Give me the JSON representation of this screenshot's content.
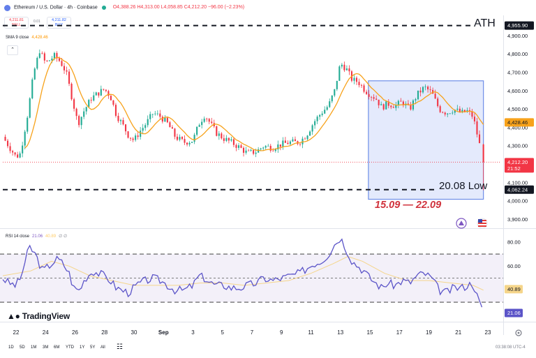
{
  "header": {
    "symbol_title": "Ethereum / U.S. Dollar · 4h · Coinbase",
    "open": "O4,388.26",
    "high": "H4,313.00",
    "low": "L4,058.85",
    "close": "C4,212.20",
    "change": "−96.00 (−2.23%)"
  },
  "trade": {
    "sell_price": "4,211.81",
    "sell_label": "SELL",
    "spread": "0.01",
    "buy_price": "4,211.82",
    "buy_label": "BUY"
  },
  "sma_legend": {
    "name": "SMA 9 close",
    "value": "4,428.46"
  },
  "rsi_legend": {
    "name": "RSI 14 close",
    "value1": "21.06",
    "value2": "40.89",
    "extra": "∅ ∅"
  },
  "brand": {
    "name": "TradingView"
  },
  "timeframes": [
    "1D",
    "5D",
    "1M",
    "3M",
    "6M",
    "YTD",
    "1Y",
    "5Y",
    "All"
  ],
  "clock": "03:38:08 UTC-4",
  "colors": {
    "up": "#22ab94",
    "down": "#f23645",
    "sma": "#f7a21b",
    "rsi": "#5b54c8",
    "rsi_ma": "#f5d58a",
    "box_fill": "#dbe3fb",
    "box_stroke": "#6e8ee8",
    "annot": "#d0323c"
  },
  "chart_data": [
    {
      "type": "candlestick",
      "title": "Ethereum / U.S. Dollar · 4h · Coinbase",
      "y_ticks": [
        4900,
        4800,
        4700,
        4600,
        4500,
        4400,
        4300,
        4200,
        4100,
        4000,
        3900
      ],
      "y_tick_labels": [
        "4,900.00",
        "4,800.00",
        "4,700.00",
        "4,600.00",
        "4,500.00",
        "4,400.00",
        "4,300.00",
        "4,200.00",
        "4,100.00",
        "4,000.00",
        "3,900.00"
      ],
      "ylim": [
        3860,
        5000
      ],
      "x_ticks": [
        "22",
        "24",
        "26",
        "28",
        "30",
        "Sep",
        "3",
        "5",
        "7",
        "9",
        "11",
        "13",
        "15",
        "17",
        "19",
        "21",
        "23"
      ],
      "x_tick_days": [
        0,
        2,
        4,
        6,
        8,
        10,
        12,
        14,
        16,
        18,
        20,
        22,
        24,
        26,
        28,
        30,
        32
      ],
      "xlim_days": [
        -0.9,
        32.9
      ],
      "sma_period": 9,
      "price_path": [
        [
          -0.9,
          4350
        ],
        [
          -0.5,
          4300
        ],
        [
          0,
          4240
        ],
        [
          0.3,
          4260
        ],
        [
          0.8,
          4480
        ],
        [
          1.2,
          4700
        ],
        [
          1.6,
          4820
        ],
        [
          2.0,
          4750
        ],
        [
          2.6,
          4790
        ],
        [
          3.0,
          4760
        ],
        [
          3.4,
          4700
        ],
        [
          3.8,
          4560
        ],
        [
          4.2,
          4420
        ],
        [
          4.6,
          4490
        ],
        [
          5.1,
          4560
        ],
        [
          5.6,
          4590
        ],
        [
          6.0,
          4610
        ],
        [
          6.4,
          4570
        ],
        [
          6.8,
          4470
        ],
        [
          7.2,
          4420
        ],
        [
          7.6,
          4360
        ],
        [
          8.0,
          4330
        ],
        [
          8.4,
          4380
        ],
        [
          8.8,
          4420
        ],
        [
          9.3,
          4480
        ],
        [
          9.8,
          4460
        ],
        [
          10.3,
          4420
        ],
        [
          10.8,
          4350
        ],
        [
          11.4,
          4320
        ],
        [
          12.0,
          4330
        ],
        [
          12.4,
          4420
        ],
        [
          12.8,
          4470
        ],
        [
          13.2,
          4420
        ],
        [
          13.6,
          4370
        ],
        [
          14.1,
          4340
        ],
        [
          14.6,
          4320
        ],
        [
          15.2,
          4290
        ],
        [
          15.7,
          4260
        ],
        [
          16.3,
          4270
        ],
        [
          16.8,
          4300
        ],
        [
          17.4,
          4290
        ],
        [
          18.0,
          4310
        ],
        [
          18.6,
          4320
        ],
        [
          19.2,
          4320
        ],
        [
          19.7,
          4360
        ],
        [
          20.2,
          4430
        ],
        [
          20.7,
          4480
        ],
        [
          21.2,
          4520
        ],
        [
          21.6,
          4600
        ],
        [
          22.0,
          4750
        ],
        [
          22.4,
          4720
        ],
        [
          22.8,
          4660
        ],
        [
          23.2,
          4650
        ],
        [
          23.6,
          4610
        ],
        [
          24.0,
          4580
        ],
        [
          24.4,
          4560
        ],
        [
          24.8,
          4510
        ],
        [
          25.2,
          4530
        ],
        [
          25.7,
          4520
        ],
        [
          26.2,
          4540
        ],
        [
          26.7,
          4500
        ],
        [
          27.2,
          4580
        ],
        [
          27.7,
          4620
        ],
        [
          28.2,
          4590
        ],
        [
          28.7,
          4500
        ],
        [
          29.2,
          4480
        ],
        [
          29.7,
          4500
        ],
        [
          30.2,
          4480
        ],
        [
          30.6,
          4490
        ],
        [
          31.0,
          4460
        ],
        [
          31.4,
          4320
        ],
        [
          31.7,
          4212
        ]
      ],
      "last_candle": {
        "open": 4308.2,
        "high": 4313.0,
        "low": 4058.85,
        "close": 4212.2
      },
      "current_price_label": "4,212.20",
      "countdown": "21:52",
      "sma_last_label": "4,428.46",
      "annotations": {
        "ath_line": 4955.9,
        "ath_label": "ATH",
        "ath_price_label": "4,955.90",
        "low_line": 4062.24,
        "low_label": "20.08 Low",
        "low_price_label": "4,062.24",
        "range_box": {
          "from_day": 23.9,
          "to_day": 31.7,
          "top": 4655,
          "bottom": 4010
        },
        "range_label": "15.09 — 22.09"
      }
    },
    {
      "type": "line",
      "title": "RSI 14 close",
      "y_ticks": [
        80,
        60
      ],
      "y_tick_labels": [
        "80.00",
        "60.00"
      ],
      "ylim": [
        15,
        88
      ],
      "levels": [
        70,
        50,
        30
      ],
      "series": [
        {
          "name": "RSI 14 close",
          "points": [
            [
              -0.9,
              50
            ],
            [
              -0.5,
              46
            ],
            [
              0,
              44
            ],
            [
              0.3,
              50
            ],
            [
              0.9,
              76
            ],
            [
              1.3,
              70
            ],
            [
              1.8,
              56
            ],
            [
              2.4,
              62
            ],
            [
              2.8,
              66
            ],
            [
              3.2,
              62
            ],
            [
              3.6,
              54
            ],
            [
              3.9,
              42
            ],
            [
              4.3,
              40
            ],
            [
              4.7,
              50
            ],
            [
              5.2,
              56
            ],
            [
              5.6,
              54
            ],
            [
              6.0,
              52
            ],
            [
              6.4,
              48
            ],
            [
              6.8,
              42
            ],
            [
              7.2,
              40
            ],
            [
              7.6,
              38
            ],
            [
              8.0,
              42
            ],
            [
              8.4,
              46
            ],
            [
              8.8,
              48
            ],
            [
              9.3,
              50
            ],
            [
              9.8,
              48
            ],
            [
              10.3,
              44
            ],
            [
              10.8,
              40
            ],
            [
              11.4,
              40
            ],
            [
              12.0,
              44
            ],
            [
              12.4,
              52
            ],
            [
              12.8,
              50
            ],
            [
              13.2,
              46
            ],
            [
              13.6,
              44
            ],
            [
              14.1,
              44
            ],
            [
              14.6,
              42
            ],
            [
              15.2,
              42
            ],
            [
              15.7,
              44
            ],
            [
              16.3,
              46
            ],
            [
              16.8,
              50
            ],
            [
              17.4,
              48
            ],
            [
              18.0,
              50
            ],
            [
              18.6,
              52
            ],
            [
              19.2,
              54
            ],
            [
              19.7,
              58
            ],
            [
              20.2,
              62
            ],
            [
              20.7,
              64
            ],
            [
              21.2,
              70
            ],
            [
              21.6,
              78
            ],
            [
              22.0,
              84
            ],
            [
              22.4,
              74
            ],
            [
              22.8,
              64
            ],
            [
              23.2,
              60
            ],
            [
              23.6,
              56
            ],
            [
              24.0,
              50
            ],
            [
              24.4,
              46
            ],
            [
              24.8,
              42
            ],
            [
              25.2,
              46
            ],
            [
              25.7,
              44
            ],
            [
              26.2,
              48
            ],
            [
              26.7,
              46
            ],
            [
              27.2,
              52
            ],
            [
              27.7,
              54
            ],
            [
              28.2,
              50
            ],
            [
              28.7,
              40
            ],
            [
              29.2,
              38
            ],
            [
              29.7,
              42
            ],
            [
              30.2,
              42
            ],
            [
              30.6,
              44
            ],
            [
              31.0,
              46
            ],
            [
              31.3,
              34
            ],
            [
              31.7,
              21
            ]
          ]
        },
        {
          "name": "RSI MA",
          "points": [
            [
              -0.9,
              52
            ],
            [
              1,
              56
            ],
            [
              2.4,
              64
            ],
            [
              3.6,
              60
            ],
            [
              5,
              52
            ],
            [
              6.5,
              48
            ],
            [
              8,
              44
            ],
            [
              9.5,
              44
            ],
            [
              11,
              44
            ],
            [
              12.5,
              46
            ],
            [
              14,
              46
            ],
            [
              15.5,
              44
            ],
            [
              17,
              46
            ],
            [
              18.5,
              48
            ],
            [
              20,
              54
            ],
            [
              21.5,
              62
            ],
            [
              22.5,
              68
            ],
            [
              23.5,
              64
            ],
            [
              25,
              54
            ],
            [
              26.5,
              48
            ],
            [
              28,
              48
            ],
            [
              29.5,
              46
            ],
            [
              31,
              44
            ],
            [
              31.7,
              40
            ]
          ]
        }
      ],
      "value_labels": [
        "40.89",
        "21.06"
      ]
    }
  ]
}
